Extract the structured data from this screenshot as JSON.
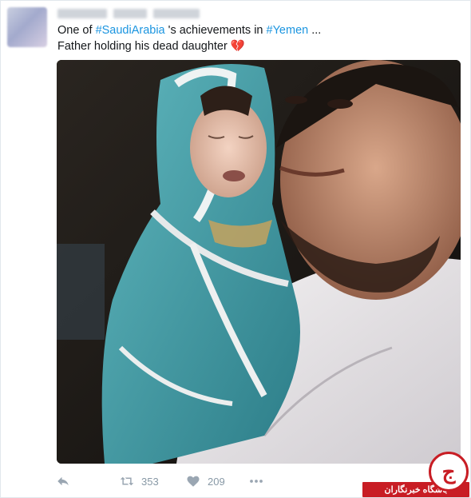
{
  "tweet": {
    "text_prefix": "One of ",
    "hashtag_1": "#SaudiArabia",
    "text_middle": " 's achievements in ",
    "hashtag_2": "#Yemen",
    "text_suffix": " ...",
    "line_2": "Father holding his dead daughter ",
    "emoji": "💔"
  },
  "actions": {
    "reply_icon": "reply-icon",
    "retweet_icon": "retweet-icon",
    "retweet_count": "353",
    "like_icon": "heart-icon",
    "like_count": "209",
    "more_icon": "more-dots-icon"
  },
  "watermark": {
    "logo_letter": "ج",
    "text": "باشگاه خبرنگاران",
    "color": "#c81d24"
  },
  "colors": {
    "hashtag": "#1b95e0",
    "action_icons": "#9aa6b2"
  }
}
